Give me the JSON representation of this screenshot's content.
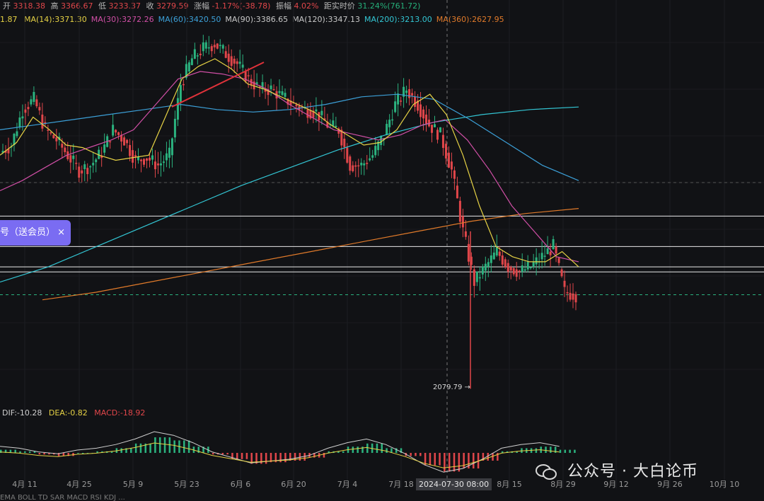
{
  "header": {
    "open_label": "开",
    "open": "3318.38",
    "high_label": "高",
    "high": "3366.67",
    "low_label": "低",
    "low": "3233.37",
    "close_label": "收",
    "close": "3279.59",
    "change_label": "涨幅",
    "change": "-1.17%(-38.78)",
    "amplitude_label": "振幅",
    "amplitude": "4.02%",
    "distance_label": "距实时价",
    "distance": "31.24%(761.72)"
  },
  "ma_row": {
    "first": "1.87",
    "items": [
      {
        "label": "MA(14):3371.30",
        "color": "#e6d245"
      },
      {
        "label": "MA(30):3272.26",
        "color": "#d04fa6"
      },
      {
        "label": "MA(60):3420.50",
        "color": "#3ca0d8"
      },
      {
        "label": "MA(90):3386.65",
        "color": "#c8c8c8"
      },
      {
        "label": "MA(120):3347.13",
        "color": "#c8c8c8"
      },
      {
        "label": "MA(200):3213.00",
        "color": "#33c6d4"
      },
      {
        "label": "MA(360):2627.95",
        "color": "#e07a2a"
      }
    ]
  },
  "promo": {
    "text": "号（送会员）",
    "close": "×"
  },
  "macd": {
    "dif": "DIF:-10.28",
    "dea": "DEA:-0.82",
    "macd": "MACD:-18.92"
  },
  "low_marker": "2079.79",
  "crosshair_date": "2024-07-30 08:00",
  "watermark": "公众号 · 大白论币",
  "toolbar": "EMA  BOLL  TD  SAR  MACD  RSI  KDJ  ...",
  "colors": {
    "up": "#2bb37f",
    "down": "#e0464a",
    "bg": "#111215"
  },
  "chart_data": {
    "type": "line",
    "x_ticks": [
      "4月 11",
      "4月 25",
      "5月 9",
      "5月 23",
      "6月 6",
      "6月 20",
      "7月 4",
      "7月 18",
      "8月 15",
      "8月 29",
      "9月 12",
      "9月 26",
      "10月 10"
    ],
    "price_path": [
      3010,
      3040,
      3180,
      3220,
      3100,
      3060,
      3000,
      2940,
      2960,
      3010,
      3100,
      3060,
      2980,
      2990,
      2960,
      3000,
      3280,
      3380,
      3420,
      3440,
      3400,
      3360,
      3300,
      3260,
      3260,
      3230,
      3200,
      3180,
      3170,
      3120,
      3100,
      2960,
      2960,
      3000,
      3080,
      3200,
      3260,
      3200,
      3120,
      3080,
      2940,
      2700,
      2500,
      2560,
      2620,
      2560,
      2540,
      2560,
      2600,
      2640,
      2460,
      2450
    ],
    "ma14": [
      3000,
      3050,
      3150,
      3100,
      3040,
      3030,
      3000,
      2980,
      2990,
      3000,
      3150,
      3300,
      3350,
      3380,
      3340,
      3280,
      3260,
      3230,
      3200,
      3170,
      3120,
      3080,
      3040,
      3050,
      3100,
      3200,
      3240,
      3160,
      3000,
      2800,
      2640,
      2600,
      2580,
      2580,
      2620,
      2560
    ],
    "ma30": [
      2860,
      2900,
      2950,
      3000,
      3030,
      3060,
      3100,
      3200,
      3300,
      3330,
      3320,
      3300,
      3260,
      3200,
      3150,
      3100,
      3080,
      3060,
      3080,
      3120,
      3140,
      3060,
      2940,
      2800,
      2700,
      2600,
      2580
    ],
    "ma60": [
      3100,
      3120,
      3140,
      3160,
      3180,
      3200,
      3180,
      3170,
      3180,
      3200,
      3230,
      3240,
      3220,
      3140,
      3050,
      2960,
      2900
    ],
    "ma200": [
      2500,
      2560,
      2640,
      2720,
      2800,
      2880,
      2950,
      3020,
      3080,
      3130,
      3160,
      3180,
      3190
    ],
    "ma360": [
      2430,
      2460,
      2500,
      2540,
      2580,
      2620,
      2660,
      2700,
      2740,
      2770,
      2790
    ],
    "horizontal_levels": [
      2760,
      2640,
      2560,
      2540
    ],
    "low": 2079.79,
    "macd_hist": [
      2,
      1,
      -1,
      -2,
      0,
      1,
      3,
      6,
      10,
      8,
      4,
      -1,
      -4,
      -7,
      -6,
      -5,
      -3,
      1,
      4,
      6,
      3,
      -2,
      -8,
      -12,
      -10,
      -5,
      1,
      3,
      4,
      2
    ]
  }
}
